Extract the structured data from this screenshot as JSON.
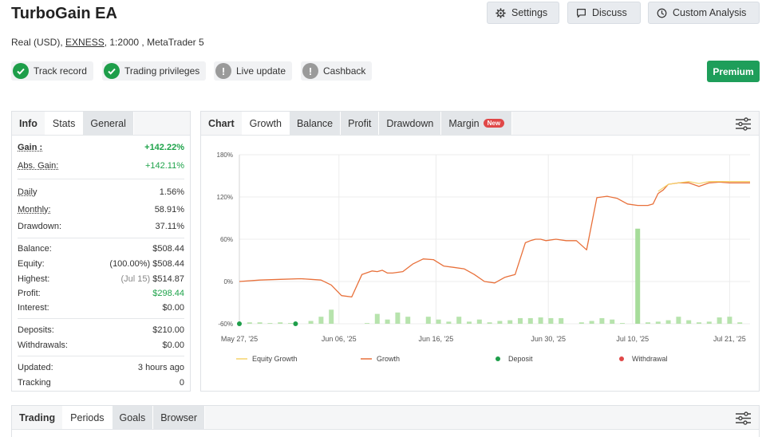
{
  "header": {
    "title": "TurboGain EA",
    "account_type": "Real (USD),",
    "broker": "EXNESS",
    "details": ", 1:2000 , MetaTrader 5"
  },
  "actions": {
    "settings": "Settings",
    "discuss": "Discuss",
    "custom_analysis": "Custom Analysis"
  },
  "badges": [
    {
      "label": "Track record",
      "status": "ok"
    },
    {
      "label": "Trading privileges",
      "status": "ok"
    },
    {
      "label": "Live update",
      "status": "warn"
    },
    {
      "label": "Cashback",
      "status": "warn"
    }
  ],
  "premium_label": "Premium",
  "info_tabs": [
    "Info",
    "Stats",
    "General"
  ],
  "stats": {
    "gain": {
      "label": "Gain :",
      "value": "+142.22%"
    },
    "abs_gain": {
      "label": "Abs. Gain:",
      "value": "+142.11%"
    },
    "daily": {
      "label": "Daily",
      "value": "1.56%"
    },
    "monthly": {
      "label": "Monthly:",
      "value": "58.91%"
    },
    "drawdown": {
      "label": "Drawdown:",
      "value": "37.11%"
    },
    "balance": {
      "label": "Balance:",
      "value": "$508.44"
    },
    "equity": {
      "label": "Equity:",
      "prefix": "(100.00%)",
      "value": "$508.44"
    },
    "highest": {
      "label": "Highest:",
      "prefix": "(Jul 15)",
      "value": "$514.87"
    },
    "profit": {
      "label": "Profit:",
      "value": "$298.44"
    },
    "interest": {
      "label": "Interest:",
      "value": "$0.00"
    },
    "deposits": {
      "label": "Deposits:",
      "value": "$210.00"
    },
    "withdrawals": {
      "label": "Withdrawals:",
      "value": "$0.00"
    },
    "updated": {
      "label": "Updated:",
      "value": "3 hours ago"
    },
    "tracking": {
      "label": "Tracking",
      "value": "0"
    }
  },
  "chart_tabs": [
    "Chart",
    "Growth",
    "Balance",
    "Profit",
    "Drawdown",
    "Margin"
  ],
  "new_tag": "New",
  "bottom_tabs": [
    "Trading",
    "Periods",
    "Goals",
    "Browser"
  ],
  "colors": {
    "green": "#1ea34a",
    "growth_line": "#e8703a",
    "equity_line": "#f5d36a",
    "bar": "#b7e3ad",
    "bar_highlight": "#a6dc9a",
    "deposit": "#1e9e4a",
    "withdrawal": "#e04848",
    "premium": "#1e9e5a"
  },
  "chart_data": {
    "type": "line",
    "y_ticks": [
      "180%",
      "120%",
      "60%",
      "0%",
      "-60%"
    ],
    "ylim": [
      -60,
      180
    ],
    "x_ticks": [
      "May 27, '25",
      "Jun 06, '25",
      "Jun 16, '25",
      "Jun 30, '25",
      "Jul 10, '25",
      "Jul 21, '25"
    ],
    "legend": [
      "Equity Growth",
      "Growth",
      "Deposit",
      "Withdrawal"
    ],
    "series": [
      {
        "name": "Growth",
        "x": [
          0,
          4,
          8,
          12,
          14,
          16,
          18,
          20,
          22,
          24,
          26,
          27,
          28,
          29,
          30,
          32,
          34,
          36,
          38,
          40,
          42,
          44,
          46,
          48,
          50,
          52,
          54,
          56,
          57,
          58,
          59,
          60,
          62,
          64,
          66,
          68,
          70,
          72,
          74,
          76,
          78,
          80,
          81,
          82,
          83,
          84,
          86,
          88,
          90,
          92,
          94,
          96,
          98,
          100
        ],
        "y": [
          0,
          2,
          3,
          4,
          3,
          2,
          -5,
          -20,
          -22,
          10,
          15,
          14,
          16,
          12,
          12,
          14,
          25,
          32,
          31,
          22,
          20,
          18,
          10,
          0,
          -2,
          6,
          10,
          55,
          58,
          60,
          60,
          58,
          60,
          58,
          58,
          45,
          119,
          121,
          118,
          110,
          108,
          108,
          110,
          125,
          130,
          138,
          140,
          140,
          135,
          140,
          141,
          140,
          140,
          140
        ]
      },
      {
        "name": "Equity Growth",
        "x": [
          82,
          84,
          86,
          88,
          90,
          92,
          94,
          96,
          98,
          100
        ],
        "y": [
          128,
          138,
          140,
          142,
          139,
          142,
          142,
          142,
          142,
          142
        ]
      }
    ],
    "bars": [
      {
        "x": 2,
        "v": 2
      },
      {
        "x": 4,
        "v": 2
      },
      {
        "x": 6,
        "v": 1
      },
      {
        "x": 8,
        "v": 2
      },
      {
        "x": 10,
        "v": 1
      },
      {
        "x": 14,
        "v": 4
      },
      {
        "x": 16,
        "v": 10
      },
      {
        "x": 18,
        "v": 20
      },
      {
        "x": 25,
        "v": 1
      },
      {
        "x": 27,
        "v": 14
      },
      {
        "x": 29,
        "v": 6
      },
      {
        "x": 31,
        "v": 16
      },
      {
        "x": 33,
        "v": 10
      },
      {
        "x": 37,
        "v": 10
      },
      {
        "x": 39,
        "v": 6
      },
      {
        "x": 41,
        "v": 3
      },
      {
        "x": 43,
        "v": 10
      },
      {
        "x": 45,
        "v": 3
      },
      {
        "x": 47,
        "v": 6
      },
      {
        "x": 49,
        "v": 2
      },
      {
        "x": 51,
        "v": 4
      },
      {
        "x": 53,
        "v": 5
      },
      {
        "x": 55,
        "v": 8
      },
      {
        "x": 57,
        "v": 8
      },
      {
        "x": 59,
        "v": 9
      },
      {
        "x": 61,
        "v": 8
      },
      {
        "x": 63,
        "v": 8
      },
      {
        "x": 67,
        "v": 2
      },
      {
        "x": 69,
        "v": 4
      },
      {
        "x": 71,
        "v": 8
      },
      {
        "x": 73,
        "v": 6
      },
      {
        "x": 75,
        "v": 1
      },
      {
        "x": 78,
        "v": 135
      },
      {
        "x": 80,
        "v": 2
      },
      {
        "x": 82,
        "v": 3
      },
      {
        "x": 84,
        "v": 5
      },
      {
        "x": 86,
        "v": 10
      },
      {
        "x": 88,
        "v": 5
      },
      {
        "x": 90,
        "v": 2
      },
      {
        "x": 92,
        "v": 3
      },
      {
        "x": 94,
        "v": 9
      },
      {
        "x": 96,
        "v": 10
      },
      {
        "x": 98,
        "v": 2
      }
    ],
    "deposits_x": [
      0,
      11
    ],
    "grid": true,
    "legend_placement": "bottom"
  }
}
